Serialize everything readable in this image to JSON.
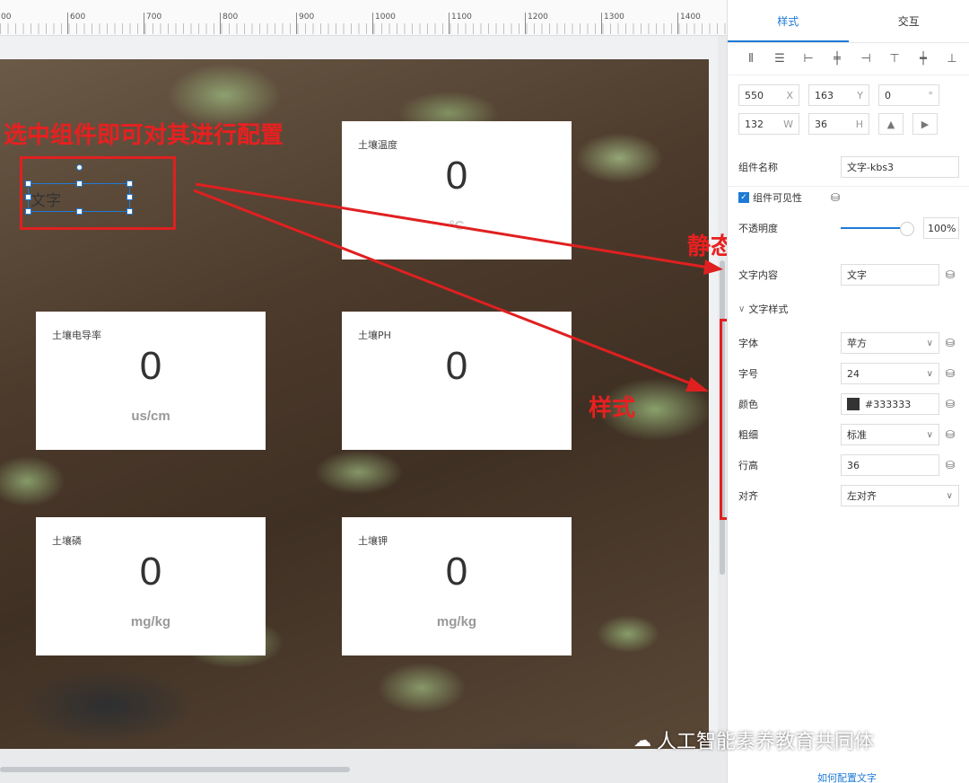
{
  "ruler": {
    "labels": [
      "00",
      "600",
      "700",
      "800",
      "900",
      "1000",
      "1100",
      "1200",
      "1300",
      "1400"
    ]
  },
  "canvas": {
    "cards": [
      {
        "title": "土壤温度",
        "value": "0",
        "unit": "°C"
      },
      {
        "title": "土壤电导率",
        "value": "0",
        "unit": "us/cm"
      },
      {
        "title": "土壤PH",
        "value": "0",
        "unit": ""
      },
      {
        "title": "土壤磷",
        "value": "0",
        "unit": "mg/kg"
      },
      {
        "title": "土壤钾",
        "value": "0",
        "unit": "mg/kg"
      }
    ],
    "selected_widget_text": "文字"
  },
  "annotations": {
    "select": "选中组件即可对其进行配置",
    "static_dynamic": "静态或动态内容",
    "style": "样式"
  },
  "panel": {
    "tabs": [
      "样式",
      "交互"
    ],
    "geometry": {
      "x": "550",
      "y": "163",
      "rotation": "0",
      "w": "132",
      "h": "36",
      "x_label": "X",
      "y_label": "Y",
      "deg_label": "°",
      "w_label": "W",
      "h_label": "H"
    },
    "component_name_label": "组件名称",
    "component_name": "文字-kbs3",
    "visibility_label": "组件可见性",
    "opacity_label": "不透明度",
    "opacity_value": "100%",
    "text_content_label": "文字内容",
    "text_content": "文字",
    "text_style_header": "文字样式",
    "font_label": "字体",
    "font_value": "苹方",
    "size_label": "字号",
    "size_value": "24",
    "color_label": "颜色",
    "color_value": "#333333",
    "weight_label": "粗细",
    "weight_value": "标准",
    "line_height_label": "行高",
    "line_height_value": "36",
    "align_label": "对齐",
    "align_value": "左对齐",
    "help_link": "如何配置文字"
  },
  "watermark": "人工智能素养教育共同体",
  "colors": {
    "accent": "#1e7ad6",
    "annotation_red": "#e02020",
    "text_color_swatch": "#333333"
  }
}
